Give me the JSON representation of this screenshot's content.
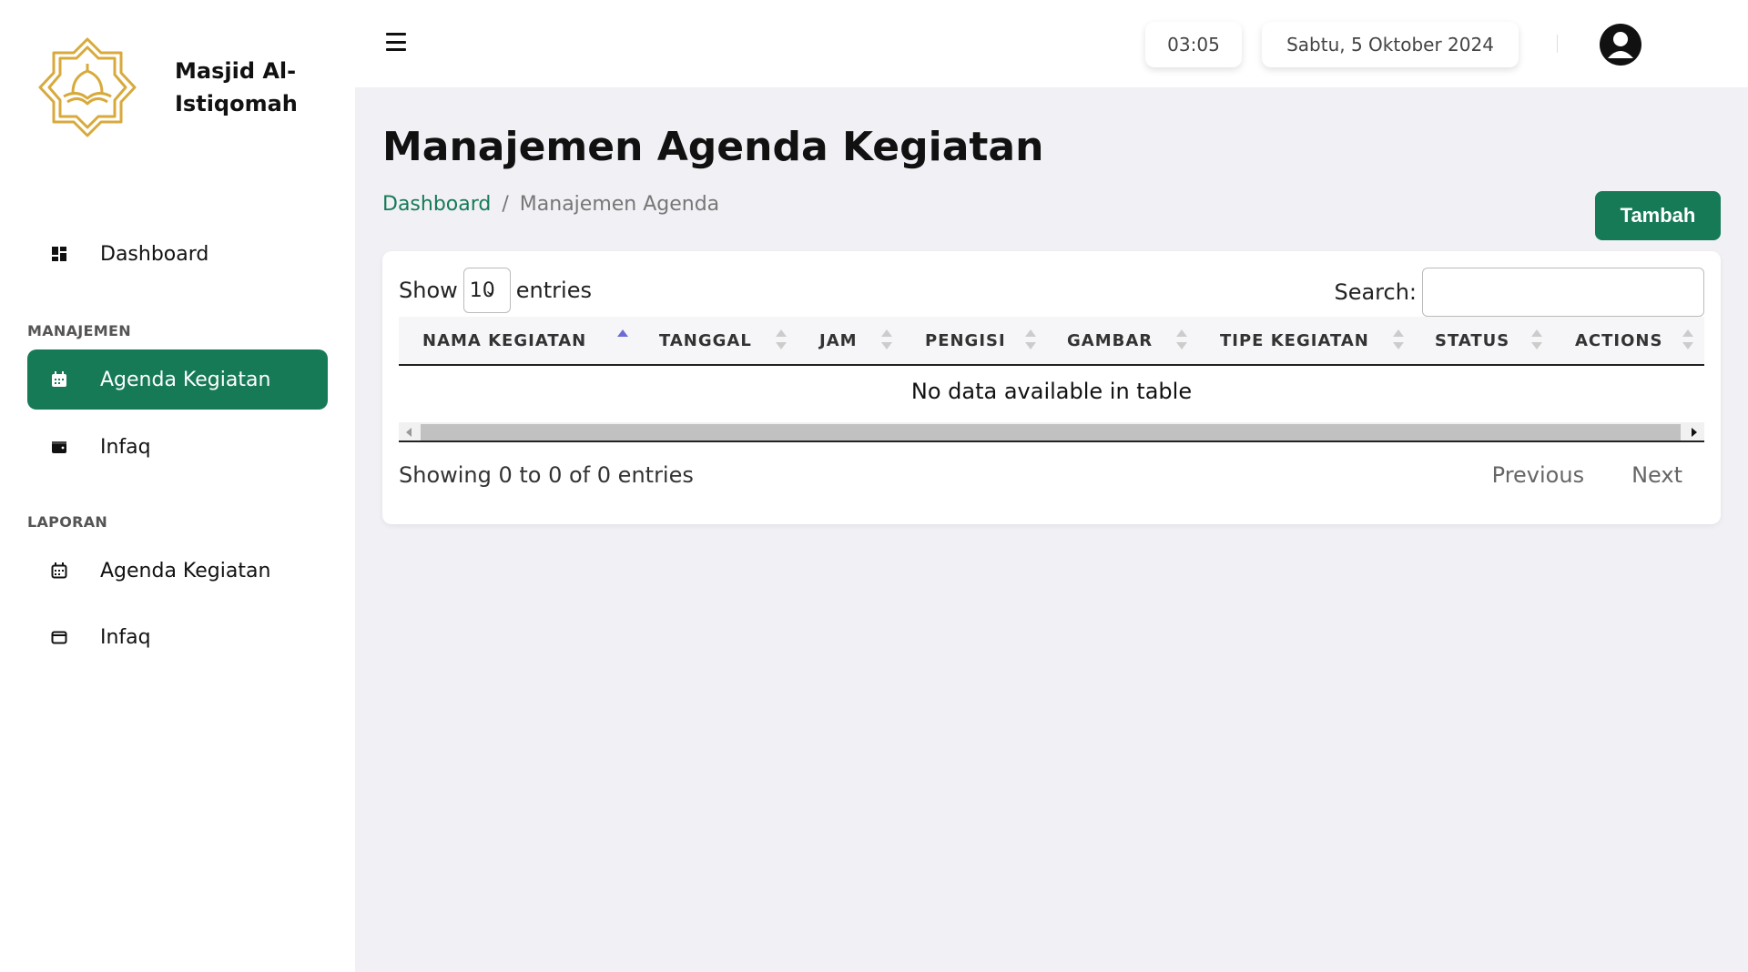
{
  "brand": {
    "name": "Masjid Al-Istiqomah",
    "accent": "#167a57",
    "logo_color": "#d8aa3c"
  },
  "sidebar": {
    "items": [
      {
        "label": "Dashboard",
        "icon": "dashboard-grid-icon"
      },
      {
        "section": "MANAJEMEN"
      },
      {
        "label": "Agenda Kegiatan",
        "icon": "calendar-icon",
        "active": true
      },
      {
        "label": "Infaq",
        "icon": "wallet-icon"
      },
      {
        "section": "LAPORAN"
      },
      {
        "label": "Agenda Kegiatan",
        "icon": "calendar-icon"
      },
      {
        "label": "Infaq",
        "icon": "wallet-outline-icon"
      }
    ]
  },
  "topbar": {
    "menu_icon": "hamburger-icon",
    "time": "03:05",
    "date": "Sabtu, 5 Oktober 2024",
    "avatar_icon": "user-circle-icon"
  },
  "page": {
    "title": "Manajemen Agenda Kegiatan",
    "breadcrumb": {
      "home": "Dashboard",
      "separator": "/",
      "current": "Manajemen Agenda"
    },
    "add_button": "Tambah"
  },
  "table": {
    "show_label": "Show",
    "page_size": "10",
    "entries_label": "entries",
    "search_label": "Search:",
    "search_value": "",
    "columns": [
      "NAMA KEGIATAN",
      "TANGGAL",
      "JAM",
      "PENGISI",
      "GAMBAR",
      "TIPE KEGIATAN",
      "STATUS",
      "ACTIONS"
    ],
    "sorted_column": "NAMA KEGIATAN",
    "sort_direction": "asc",
    "empty_message": "No data available in table",
    "info": "Showing 0 to 0 of 0 entries",
    "pager": {
      "previous": "Previous",
      "next": "Next"
    }
  }
}
